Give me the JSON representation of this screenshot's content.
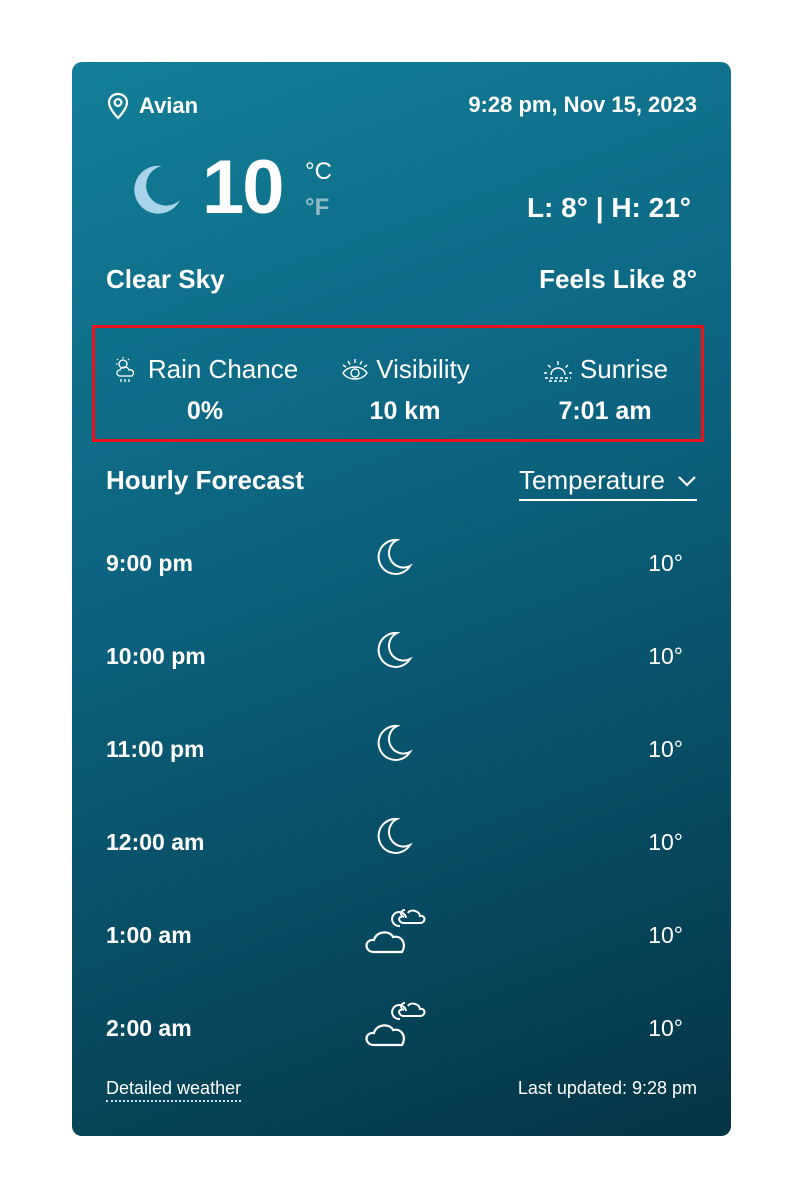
{
  "header": {
    "location": "Avian",
    "datetime": "9:28 pm, Nov 15, 2023"
  },
  "current": {
    "temp": "10",
    "unit_c": "°C",
    "unit_f": "°F",
    "low_high": "L: 8° | H: 21°",
    "condition": "Clear Sky",
    "feels_like": "Feels Like 8°",
    "icon": "moon-icon"
  },
  "stats": [
    {
      "label": "Rain Chance",
      "value": "0%",
      "icon": "rain-cloud-icon"
    },
    {
      "label": "Visibility",
      "value": "10 km",
      "icon": "eye-icon"
    },
    {
      "label": "Sunrise",
      "value": "7:01 am",
      "icon": "sunrise-icon"
    }
  ],
  "hourly": {
    "title": "Hourly Forecast",
    "selector": "Temperature",
    "rows": [
      {
        "time": "9:00 pm",
        "temp": "10°",
        "icon": "moon-icon"
      },
      {
        "time": "10:00 pm",
        "temp": "10°",
        "icon": "moon-icon"
      },
      {
        "time": "11:00 pm",
        "temp": "10°",
        "icon": "moon-icon"
      },
      {
        "time": "12:00 am",
        "temp": "10°",
        "icon": "moon-icon"
      },
      {
        "time": "1:00 am",
        "temp": "10°",
        "icon": "cloud-moon-icon"
      },
      {
        "time": "2:00 am",
        "temp": "10°",
        "icon": "cloud-moon-icon"
      }
    ]
  },
  "footer": {
    "detail_link": "Detailed weather",
    "last_updated": "Last updated: 9:28 pm"
  },
  "colors": {
    "card_top": "#137f97",
    "card_bottom": "#033444",
    "highlight_border": "#e8131c",
    "fahrenheit_muted": "#8fb9c6",
    "moon_fill": "#a8d3ea"
  }
}
